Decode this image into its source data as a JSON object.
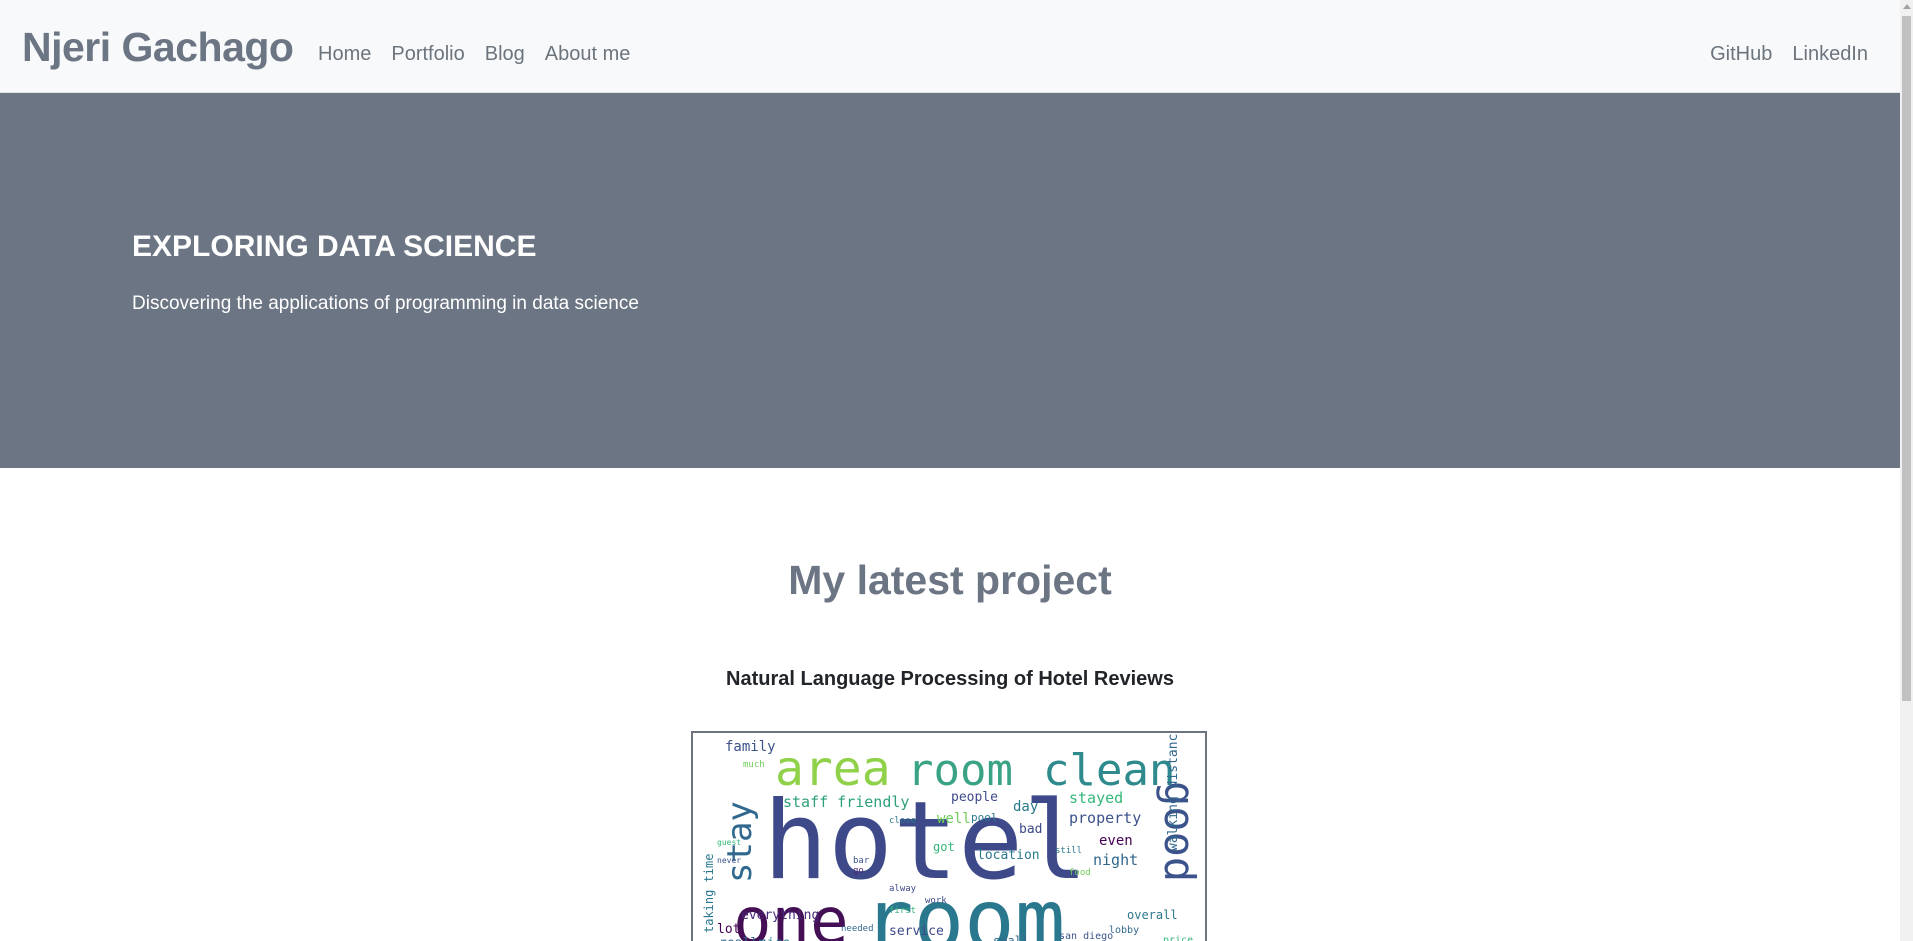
{
  "navbar": {
    "brand": "Njeri Gachago",
    "left_links": [
      "Home",
      "Portfolio",
      "Blog",
      "About me"
    ],
    "right_links": [
      "GitHub",
      "LinkedIn"
    ]
  },
  "hero": {
    "title": "EXPLORING DATA SCIENCE",
    "subtitle": "Discovering the applications of programming in data science"
  },
  "project": {
    "heading": "My latest project",
    "name": "Natural Language Processing of Hotel Reviews",
    "image_alt": "word cloud of hotel review terms"
  },
  "colors": {
    "brand_gray": "#6c7583",
    "navbar_bg": "#f8f9fa",
    "hero_bg": "#6c7583"
  }
}
